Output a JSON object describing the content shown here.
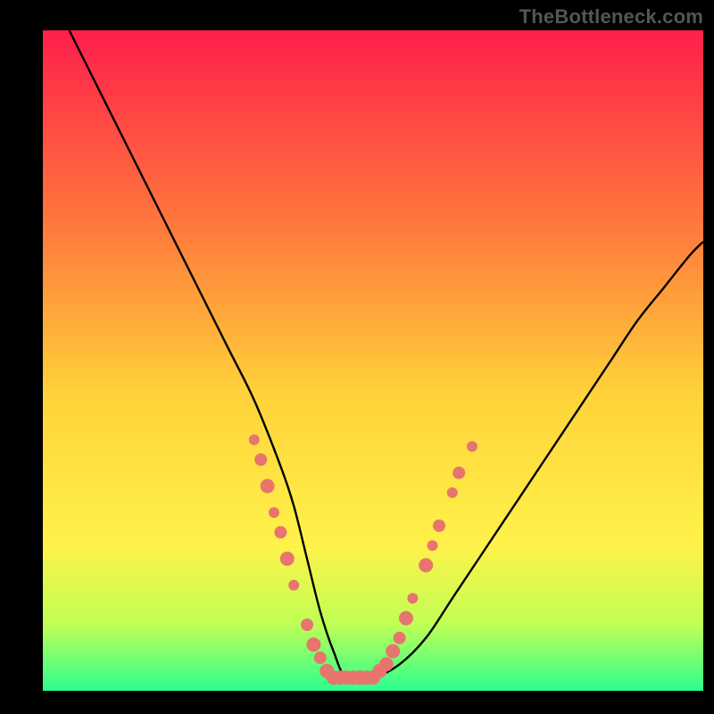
{
  "watermark": "TheBottleneck.com",
  "chart_data": {
    "type": "line",
    "title": "",
    "xlabel": "",
    "ylabel": "",
    "xlim": [
      0,
      100
    ],
    "ylim": [
      0,
      100
    ],
    "gradient_stops": [
      {
        "offset": 0,
        "color": "#ff1f4b"
      },
      {
        "offset": 30,
        "color": "#ff7a3c"
      },
      {
        "offset": 55,
        "color": "#ffd23a"
      },
      {
        "offset": 78,
        "color": "#fff24a"
      },
      {
        "offset": 90,
        "color": "#bfff55"
      },
      {
        "offset": 100,
        "color": "#2bff8f"
      }
    ],
    "series": [
      {
        "name": "bottleneck-curve",
        "x": [
          4,
          8,
          12,
          16,
          20,
          24,
          28,
          32,
          36,
          38,
          40,
          42,
          44,
          46,
          50,
          54,
          58,
          62,
          66,
          70,
          74,
          78,
          82,
          86,
          90,
          94,
          98,
          100
        ],
        "y": [
          100,
          92,
          84,
          76,
          68,
          60,
          52,
          44,
          34,
          28,
          20,
          12,
          6,
          2,
          2,
          4,
          8,
          14,
          20,
          26,
          32,
          38,
          44,
          50,
          56,
          61,
          66,
          68
        ]
      }
    ],
    "scatter": {
      "name": "marker-points",
      "color": "#e8746e",
      "radius_small": 6,
      "radius_large": 8,
      "points": [
        {
          "x": 32,
          "y": 38,
          "r": 6
        },
        {
          "x": 33,
          "y": 35,
          "r": 7
        },
        {
          "x": 34,
          "y": 31,
          "r": 8
        },
        {
          "x": 35,
          "y": 27,
          "r": 6
        },
        {
          "x": 36,
          "y": 24,
          "r": 7
        },
        {
          "x": 37,
          "y": 20,
          "r": 8
        },
        {
          "x": 38,
          "y": 16,
          "r": 6
        },
        {
          "x": 40,
          "y": 10,
          "r": 7
        },
        {
          "x": 41,
          "y": 7,
          "r": 8
        },
        {
          "x": 42,
          "y": 5,
          "r": 7
        },
        {
          "x": 43,
          "y": 3,
          "r": 8
        },
        {
          "x": 44,
          "y": 2,
          "r": 8
        },
        {
          "x": 45,
          "y": 2,
          "r": 8
        },
        {
          "x": 46,
          "y": 2,
          "r": 8
        },
        {
          "x": 47,
          "y": 2,
          "r": 8
        },
        {
          "x": 48,
          "y": 2,
          "r": 8
        },
        {
          "x": 49,
          "y": 2,
          "r": 8
        },
        {
          "x": 50,
          "y": 2,
          "r": 8
        },
        {
          "x": 51,
          "y": 3,
          "r": 8
        },
        {
          "x": 52,
          "y": 4,
          "r": 8
        },
        {
          "x": 53,
          "y": 6,
          "r": 8
        },
        {
          "x": 54,
          "y": 8,
          "r": 7
        },
        {
          "x": 55,
          "y": 11,
          "r": 8
        },
        {
          "x": 56,
          "y": 14,
          "r": 6
        },
        {
          "x": 58,
          "y": 19,
          "r": 8
        },
        {
          "x": 59,
          "y": 22,
          "r": 6
        },
        {
          "x": 60,
          "y": 25,
          "r": 7
        },
        {
          "x": 62,
          "y": 30,
          "r": 6
        },
        {
          "x": 63,
          "y": 33,
          "r": 7
        },
        {
          "x": 65,
          "y": 37,
          "r": 6
        }
      ]
    }
  }
}
